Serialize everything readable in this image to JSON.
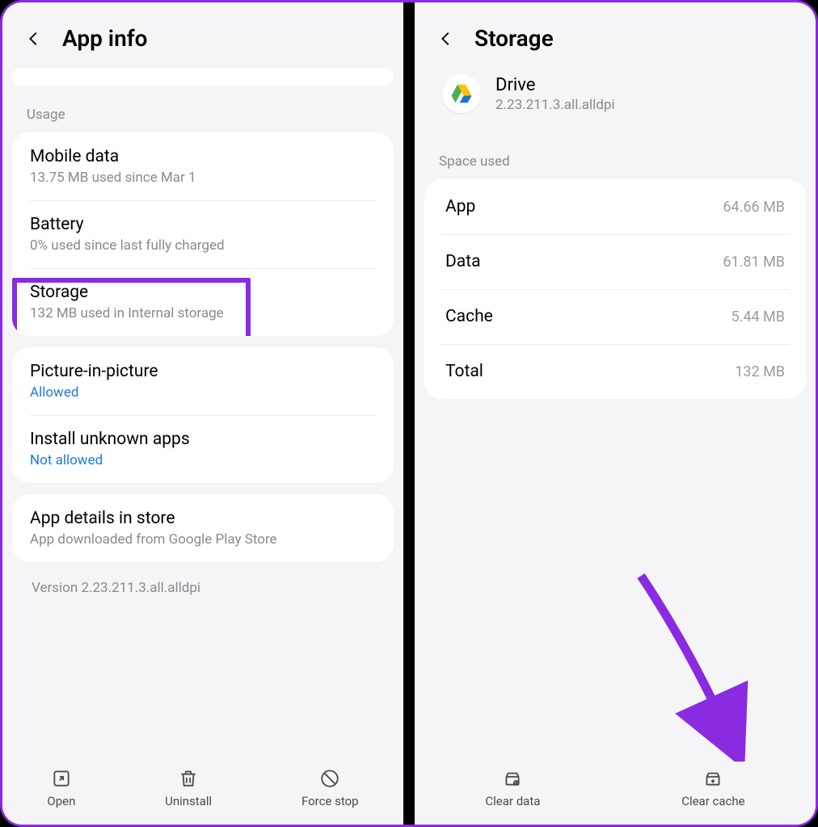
{
  "left": {
    "title": "App info",
    "usage_label": "Usage",
    "mobile_data": {
      "title": "Mobile data",
      "sub": "13.75 MB used since Mar 1"
    },
    "battery": {
      "title": "Battery",
      "sub": "0% used since last fully charged"
    },
    "storage": {
      "title": "Storage",
      "sub": "132 MB used in Internal storage"
    },
    "pip": {
      "title": "Picture-in-picture",
      "sub": "Allowed"
    },
    "unknown": {
      "title": "Install unknown apps",
      "sub": "Not allowed"
    },
    "details": {
      "title": "App details in store",
      "sub": "App downloaded from Google Play Store"
    },
    "version": "Version 2.23.211.3.all.alldpi",
    "buttons": {
      "open": "Open",
      "uninstall": "Uninstall",
      "force_stop": "Force stop"
    }
  },
  "right": {
    "title": "Storage",
    "app": {
      "name": "Drive",
      "version": "2.23.211.3.all.alldpi"
    },
    "space_label": "Space used",
    "rows": {
      "app": {
        "label": "App",
        "value": "64.66 MB"
      },
      "data": {
        "label": "Data",
        "value": "61.81 MB"
      },
      "cache": {
        "label": "Cache",
        "value": "5.44 MB"
      },
      "total": {
        "label": "Total",
        "value": "132 MB"
      }
    },
    "buttons": {
      "clear_data": "Clear data",
      "clear_cache": "Clear cache"
    }
  }
}
